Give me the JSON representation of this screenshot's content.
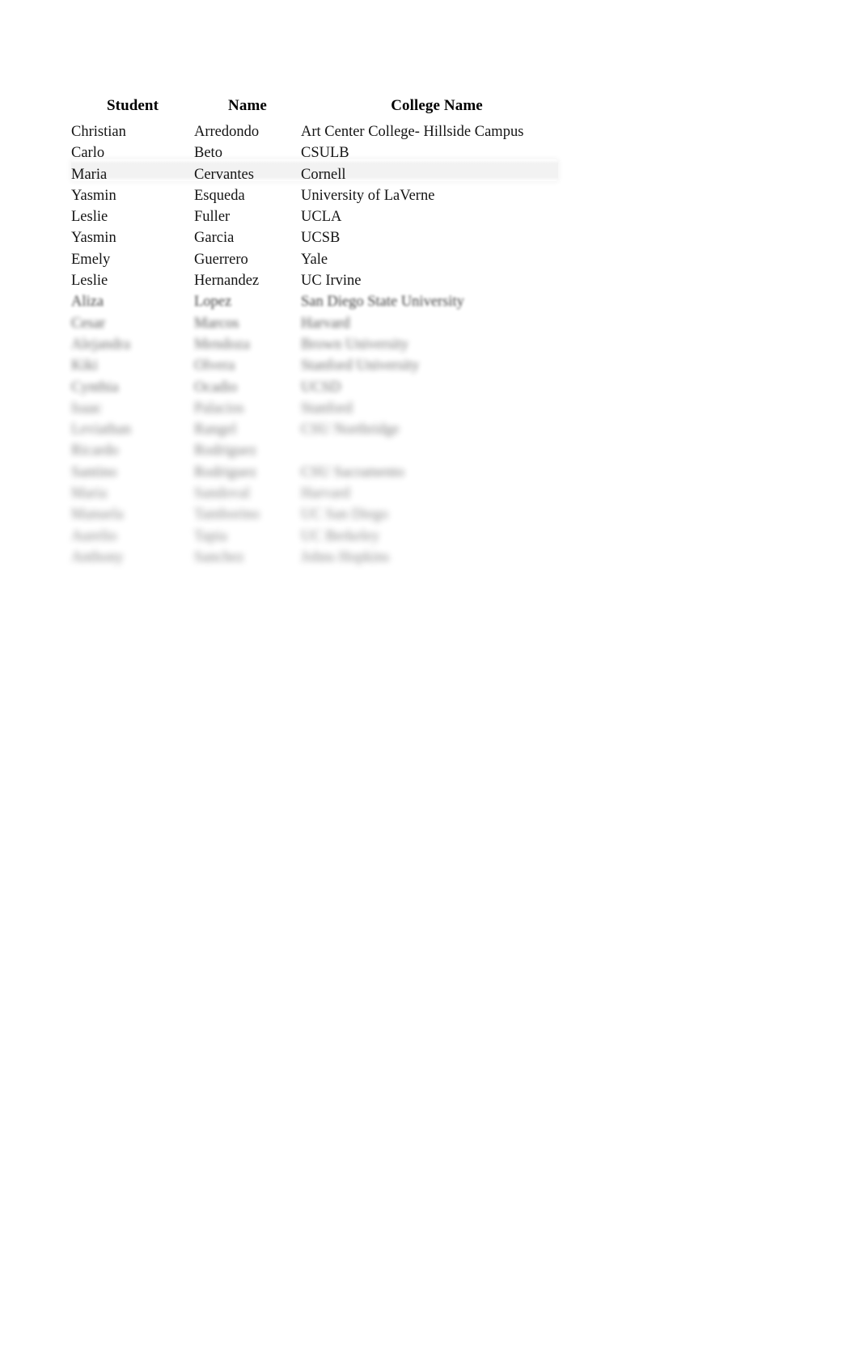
{
  "document": {
    "background_color": "#ffffff",
    "text_color": "#141414",
    "header_color": "#000000"
  },
  "table": {
    "columns": [
      {
        "key": "student",
        "label": "Student",
        "align": "center"
      },
      {
        "key": "name",
        "label": "Name",
        "align": "center"
      },
      {
        "key": "college",
        "label": "College Name",
        "align": "center"
      }
    ],
    "highlight": {
      "row_index": 2,
      "color": "#eeeeee",
      "description": "selected-row-band"
    },
    "rows": [
      {
        "student": "Christian",
        "name": "Arredondo",
        "college": "Art Center College- Hillside Campus",
        "blur": 0
      },
      {
        "student": "Carlo",
        "name": "Beto",
        "college": "CSULB",
        "blur": 0
      },
      {
        "student": "Maria",
        "name": "Cervantes",
        "college": "Cornell",
        "blur": 0
      },
      {
        "student": "Yasmin",
        "name": "Esqueda",
        "college": "University of LaVerne",
        "blur": 0
      },
      {
        "student": "Leslie",
        "name": "Fuller",
        "college": "UCLA",
        "blur": 0
      },
      {
        "student": "Yasmin",
        "name": "Garcia",
        "college": "UCSB",
        "blur": 0
      },
      {
        "student": "Emely",
        "name": "Guerrero",
        "college": "Yale",
        "blur": 0
      },
      {
        "student": "Leslie",
        "name": "Hernandez",
        "college": "UC Irvine",
        "blur": 0
      },
      {
        "student": "Aliza",
        "name": "Lopez",
        "college": "San Diego State University",
        "blur": 1
      },
      {
        "student": "Cesar",
        "name": "Marcos",
        "college": "Harvard",
        "blur": 2
      },
      {
        "student": "Alejandra",
        "name": "Mendoza",
        "college": "Brown University",
        "blur": 3
      },
      {
        "student": "Kiki",
        "name": "Olvera",
        "college": "Stanford University",
        "blur": 3
      },
      {
        "student": "Cynthia",
        "name": "Ocadio",
        "college": "UCSD",
        "blur": 3
      },
      {
        "student": "Isaac",
        "name": "Palacios",
        "college": "Stanford",
        "blur": 4
      },
      {
        "student": "Leviathan",
        "name": "Rangel",
        "college": "CSU Northridge",
        "blur": 4
      },
      {
        "student": "Ricardo",
        "name": "Rodriguez",
        "college": "",
        "blur": 4
      },
      {
        "student": "Santino",
        "name": "Rodriguez",
        "college": "CSU Sacramento",
        "blur": 4
      },
      {
        "student": "Maria",
        "name": "Sandoval",
        "college": "Harvard",
        "blur": 5
      },
      {
        "student": "Manuela",
        "name": "Tamborino",
        "college": "UC San Diego",
        "blur": 5
      },
      {
        "student": "Aurelio",
        "name": "Tapia",
        "college": "UC Berkeley",
        "blur": 5
      },
      {
        "student": "Anthony",
        "name": "Sanchez",
        "college": "Johns Hopkins",
        "blur": 5
      }
    ]
  }
}
